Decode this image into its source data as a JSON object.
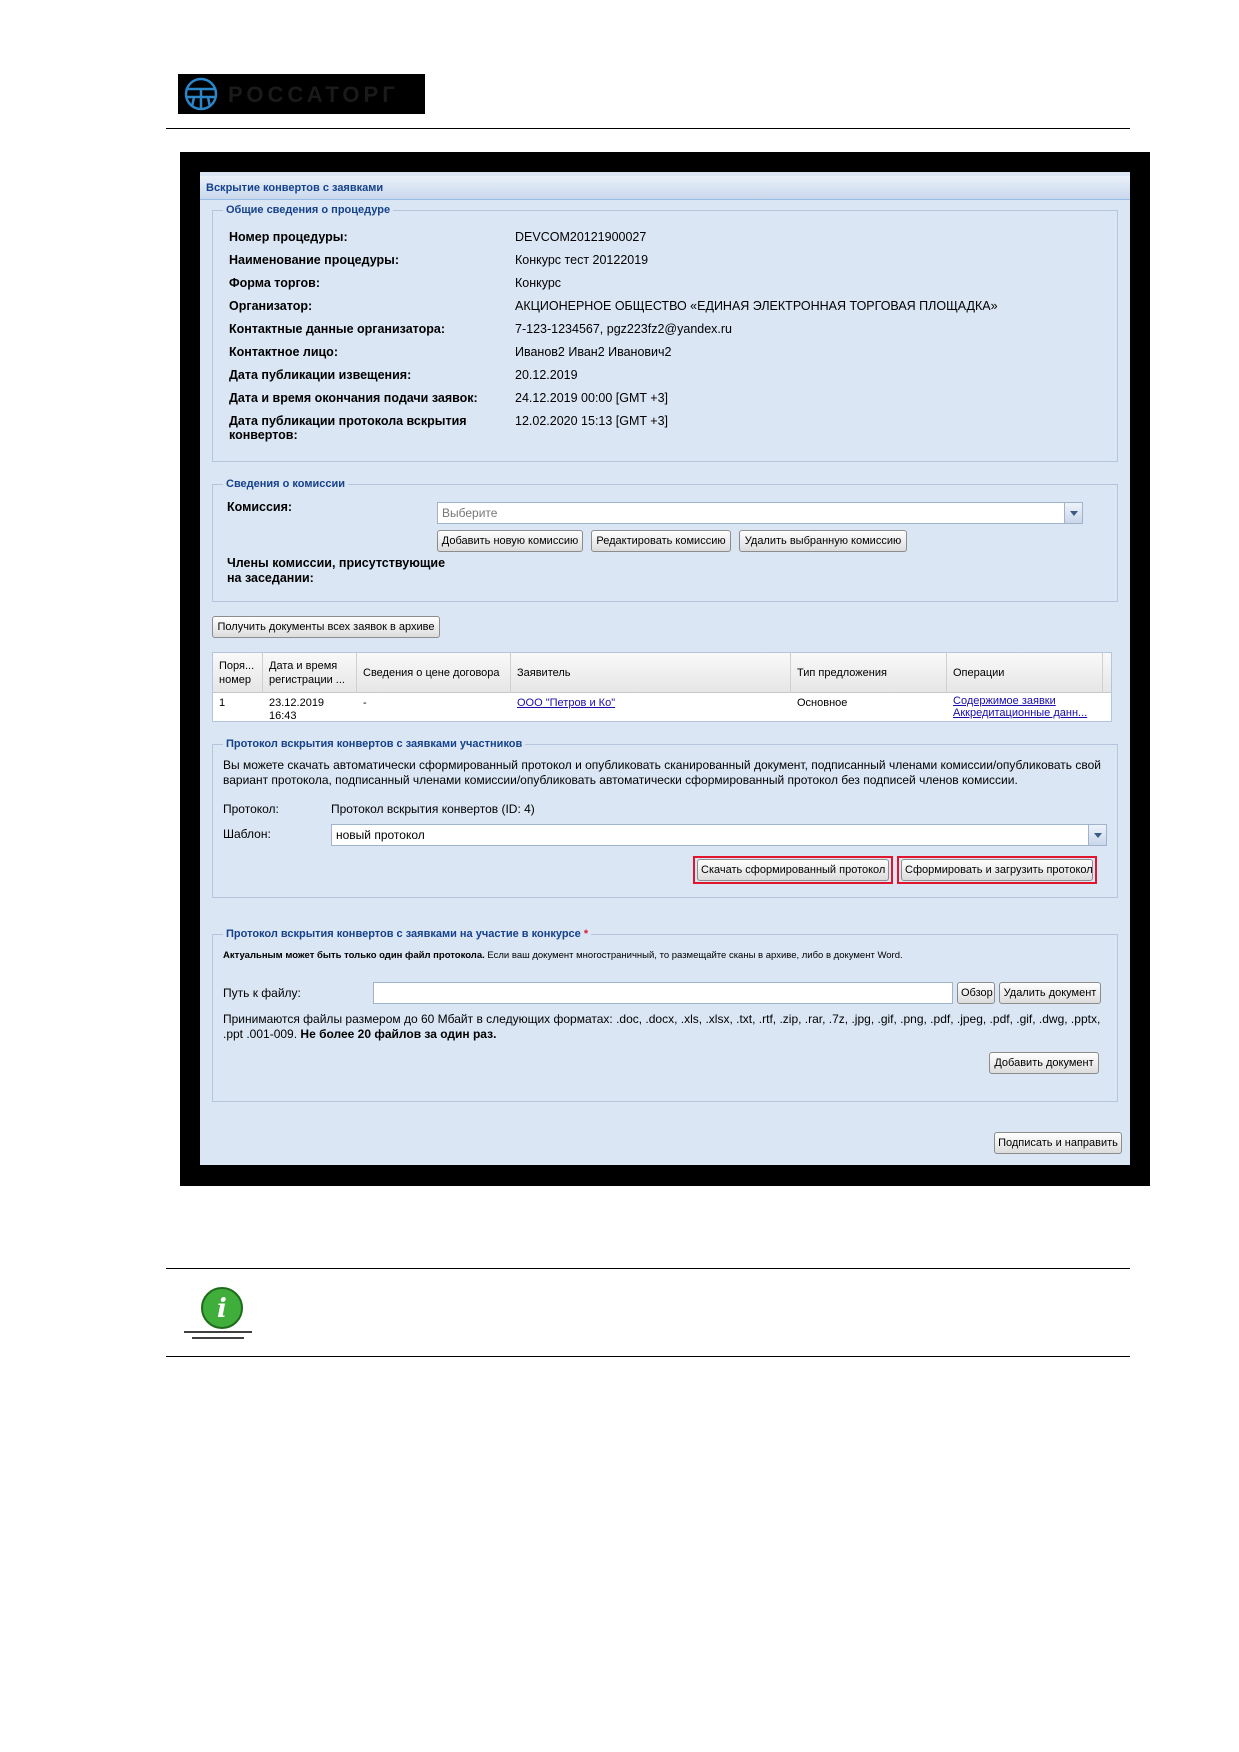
{
  "logo": {
    "text": "РОССАТОРГ"
  },
  "panel": {
    "title": "Вскрытие конвертов с заявками"
  },
  "general": {
    "legend": "Общие сведения о процедуре",
    "rows": [
      {
        "label": "Номер процедуры:",
        "value": "DEVCOM20121900027"
      },
      {
        "label": "Наименование процедуры:",
        "value": "Конкурс тест 20122019"
      },
      {
        "label": "Форма торгов:",
        "value": "Конкурс"
      },
      {
        "label": "Организатор:",
        "value": "АКЦИОНЕРНОЕ ОБЩЕСТВО «ЕДИНАЯ ЭЛЕКТРОННАЯ ТОРГОВАЯ ПЛОЩАДКА»"
      },
      {
        "label": "Контактные данные организатора:",
        "value": "7-123-1234567, pgz223fz2@yandex.ru"
      },
      {
        "label": "Контактное лицо:",
        "value": "Иванов2 Иван2 Иванович2"
      },
      {
        "label": "Дата публикации извещения:",
        "value": "20.12.2019"
      },
      {
        "label": "Дата и время окончания подачи заявок:",
        "value": "24.12.2019 00:00 [GMT +3]"
      },
      {
        "label": "Дата публикации протокола вскрытия конвертов:",
        "value": "12.02.2020 15:13 [GMT +3]"
      }
    ]
  },
  "commission": {
    "legend": "Сведения о комиссии",
    "label": "Комиссия:",
    "placeholder": "Выберите",
    "btn_add": "Добавить новую комиссию",
    "btn_edit": "Редактировать комиссию",
    "btn_delete": "Удалить выбранную комиссию",
    "members_label": "Члены комиссии, присутствующие на заседании:"
  },
  "archive_button": "Получить документы всех заявок в архиве",
  "grid": {
    "headers": [
      "Поря... номер",
      "Дата и время регистрации ...",
      "Сведения о цене договора",
      "Заявитель",
      "Тип предложения",
      "Операции"
    ],
    "row": {
      "num": "1",
      "date": "23.12.2019 16:43",
      "price": "-",
      "applicant": "ООО \"Петров и Ко\"",
      "type": "Основное",
      "op1": "Содержимое заявки",
      "op2": "Аккредитационные данн..."
    }
  },
  "protocol": {
    "legend": "Протокол вскрытия конвертов с заявками участников",
    "desc": "Вы можете скачать автоматически сформированный протокол и опубликовать сканированный документ, подписанный членами комиссии/опубликовать свой вариант протокола, подписанный членами комиссии/опубликовать автоматически сформированный протокол без подписей членов комиссии.",
    "protocol_label": "Протокол:",
    "protocol_value": "Протокол вскрытия конвертов (ID: 4)",
    "template_label": "Шаблон:",
    "template_value": "новый протокол",
    "btn_download": "Скачать сформированный протокол",
    "btn_generate": "Сформировать и загрузить протокол"
  },
  "upload": {
    "legend": "Протокол вскрытия конвертов с заявками на участие в конкурсе",
    "required_mark": "*",
    "note_bold": "Актуальным может быть только один файл протокола.",
    "note_rest": " Если ваш документ многостраничный, то размещайте сканы в архиве, либо в документ Word.",
    "path_label": "Путь к файлу:",
    "btn_browse": "Обзор",
    "btn_delete": "Удалить документ",
    "formats": "Принимаются файлы размером до 60 Мбайт в следующих форматах: .doc, .docx, .xls, .xlsx, .txt, .rtf, .zip, .rar, .7z, .jpg, .gif, .png, .pdf, .jpeg, .pdf, .gif, .dwg, .pptx, .ppt .001-009.",
    "formats_bold": "Не более 20 файлов за один раз.",
    "btn_add": "Добавить документ"
  },
  "sign_button": "Подписать и направить",
  "colors": {
    "accent": "#15428b",
    "highlight": "#e1162e",
    "panel_bg": "#dbe6f4"
  },
  "icons": {
    "info": "info-icon"
  }
}
